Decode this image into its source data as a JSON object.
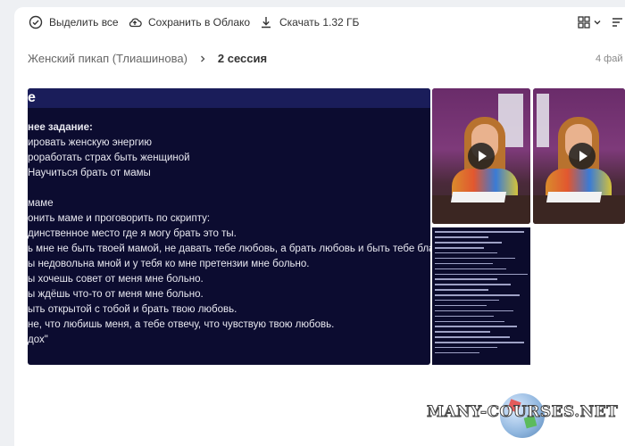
{
  "toolbar": {
    "select_all": "Выделить все",
    "save_cloud": "Сохранить в Облако",
    "download": "Скачать 1.32 ГБ"
  },
  "breadcrumb": {
    "parent": "Женский пикап (Тлиашинова)",
    "current": "2 сессия"
  },
  "file_count": "4 фай",
  "slide": {
    "header": "е",
    "lines": [
      "нее задание:",
      "ировать женскую энергию",
      "роработать страх быть женщиной",
      "Научиться брать от мамы",
      "",
      "маме",
      "онить маме и проговорить по скрипту:",
      "динственное место где я могу брать это ты.",
      "ь мне не быть твоей мамой, не давать тебе любовь, а брать любовь и быть тебе благод",
      "ы недовольна мной и у тебя ко мне претензии мне больно.",
      "ы хочешь совет от меня мне больно.",
      "ы ждёшь что-то от меня мне больно.",
      "ыть открытой с тобой и брать твою любовь.",
      "не, что любишь меня, а тебе отвечу, что чувствую твою любовь.",
      "дох\""
    ]
  },
  "watermark": "MANY-COURSES.NET"
}
